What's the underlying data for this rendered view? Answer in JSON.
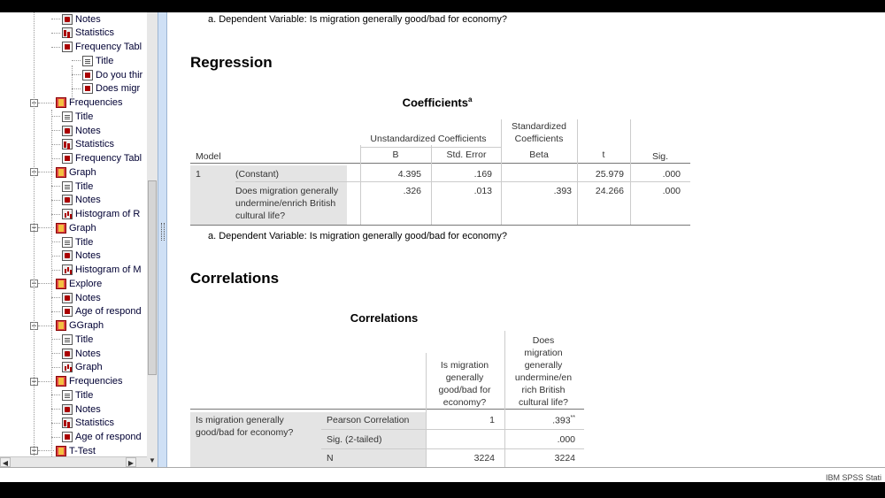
{
  "navigator": {
    "rows": [
      {
        "label": "Notes",
        "icon": "notes-icon"
      },
      {
        "label": "Statistics",
        "icon": "statistics-icon"
      },
      {
        "label": "Frequency Tabl",
        "icon": "table-icon"
      },
      {
        "label": "Title",
        "icon": "title-icon"
      },
      {
        "label": "Do you thir",
        "icon": "table-icon"
      },
      {
        "label": "Does migr",
        "icon": "table-icon"
      },
      {
        "label": "Frequencies",
        "icon": "book-icon"
      },
      {
        "label": "Title",
        "icon": "title-icon"
      },
      {
        "label": "Notes",
        "icon": "notes-icon"
      },
      {
        "label": "Statistics",
        "icon": "statistics-icon"
      },
      {
        "label": "Frequency Tabl",
        "icon": "table-icon"
      },
      {
        "label": "Graph",
        "icon": "book-icon"
      },
      {
        "label": "Title",
        "icon": "title-icon"
      },
      {
        "label": "Notes",
        "icon": "notes-icon"
      },
      {
        "label": "Histogram of R",
        "icon": "histogram-icon"
      },
      {
        "label": "Graph",
        "icon": "book-icon"
      },
      {
        "label": "Title",
        "icon": "title-icon"
      },
      {
        "label": "Notes",
        "icon": "notes-icon"
      },
      {
        "label": "Histogram of M",
        "icon": "histogram-icon"
      },
      {
        "label": "Explore",
        "icon": "book-icon"
      },
      {
        "label": "Notes",
        "icon": "notes-icon"
      },
      {
        "label": "Age of respond",
        "icon": "table-icon"
      },
      {
        "label": "GGraph",
        "icon": "book-icon"
      },
      {
        "label": "Title",
        "icon": "title-icon"
      },
      {
        "label": "Notes",
        "icon": "notes-icon"
      },
      {
        "label": "Graph",
        "icon": "histogram-icon"
      },
      {
        "label": "Frequencies",
        "icon": "book-icon"
      },
      {
        "label": "Title",
        "icon": "title-icon"
      },
      {
        "label": "Notes",
        "icon": "notes-icon"
      },
      {
        "label": "Statistics",
        "icon": "statistics-icon"
      },
      {
        "label": "Age of respond",
        "icon": "table-icon"
      },
      {
        "label": "T-Test",
        "icon": "book-icon"
      }
    ]
  },
  "output": {
    "footnote_top": "a. Dependent Variable: Is migration generally good/bad for economy?",
    "regression_heading": "Regression",
    "coefficients": {
      "title": "Coefficients",
      "title_sup": "a",
      "header_unstd": "Unstandardized Coefficients",
      "header_std_1": "Standardized",
      "header_std_2": "Coefficients",
      "col_model": "Model",
      "col_b": "B",
      "col_se": "Std. Error",
      "col_beta": "Beta",
      "col_t": "t",
      "col_sig": "Sig.",
      "model_num": "1",
      "row1": {
        "label": "(Constant)",
        "b": "4.395",
        "se": ".169",
        "beta": "",
        "t": "25.979",
        "sig": ".000"
      },
      "row2": {
        "label_1": "Does migration generally",
        "label_2": "undermine/enrich British",
        "label_3": "cultural life?",
        "b": ".326",
        "se": ".013",
        "beta": ".393",
        "t": "24.266",
        "sig": ".000"
      },
      "footnote": "a. Dependent Variable: Is migration generally good/bad for economy?"
    },
    "correlations_heading": "Correlations",
    "correlations": {
      "title": "Correlations",
      "col1": [
        "Is migration",
        "generally",
        "good/bad for",
        "economy?"
      ],
      "col2": [
        "Does",
        "migration",
        "generally",
        "undermine/en",
        "rich British",
        "cultural life?"
      ],
      "row_label_1": "Is migration generally",
      "row_label_2": "good/bad for economy?",
      "pearson_label": "Pearson Correlation",
      "pearson_v1": "1",
      "pearson_v2": ".393",
      "pearson_v2_sup": "**",
      "sig_label": "Sig. (2-tailed)",
      "sig_v2": ".000",
      "n_label": "N",
      "n_v1": "3224",
      "n_v2": "3224"
    }
  },
  "status_bar": {
    "text": "IBM SPSS Stati"
  }
}
